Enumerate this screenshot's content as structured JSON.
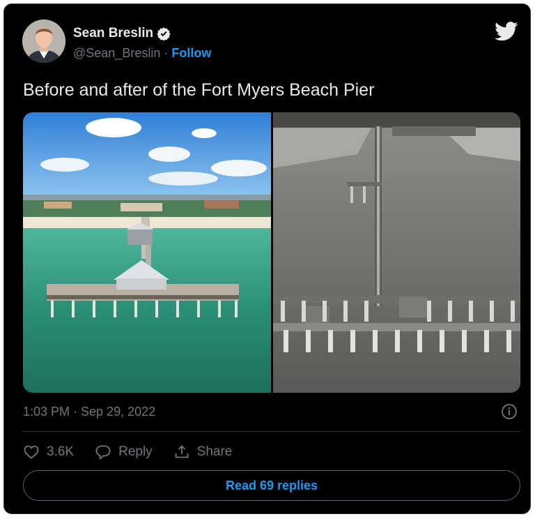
{
  "author": {
    "display_name": "Sean Breslin",
    "handle": "@Sean_Breslin",
    "separator": " · ",
    "follow_label": "Follow"
  },
  "tweet": {
    "text": "Before and after of the Fort Myers Beach Pier",
    "timestamp": "1:03 PM · Sep 29, 2022"
  },
  "actions": {
    "like_count": "3.6K",
    "reply_label": "Reply",
    "share_label": "Share"
  },
  "read_replies_label": "Read 69 replies",
  "colors": {
    "background": "#000000",
    "text_primary": "#e7e9ea",
    "text_secondary": "#71767b",
    "accent": "#1d9bf0"
  },
  "icons": [
    "verified-badge-icon",
    "twitter-bird-icon",
    "info-icon",
    "heart-icon",
    "reply-bubble-icon",
    "share-icon"
  ]
}
